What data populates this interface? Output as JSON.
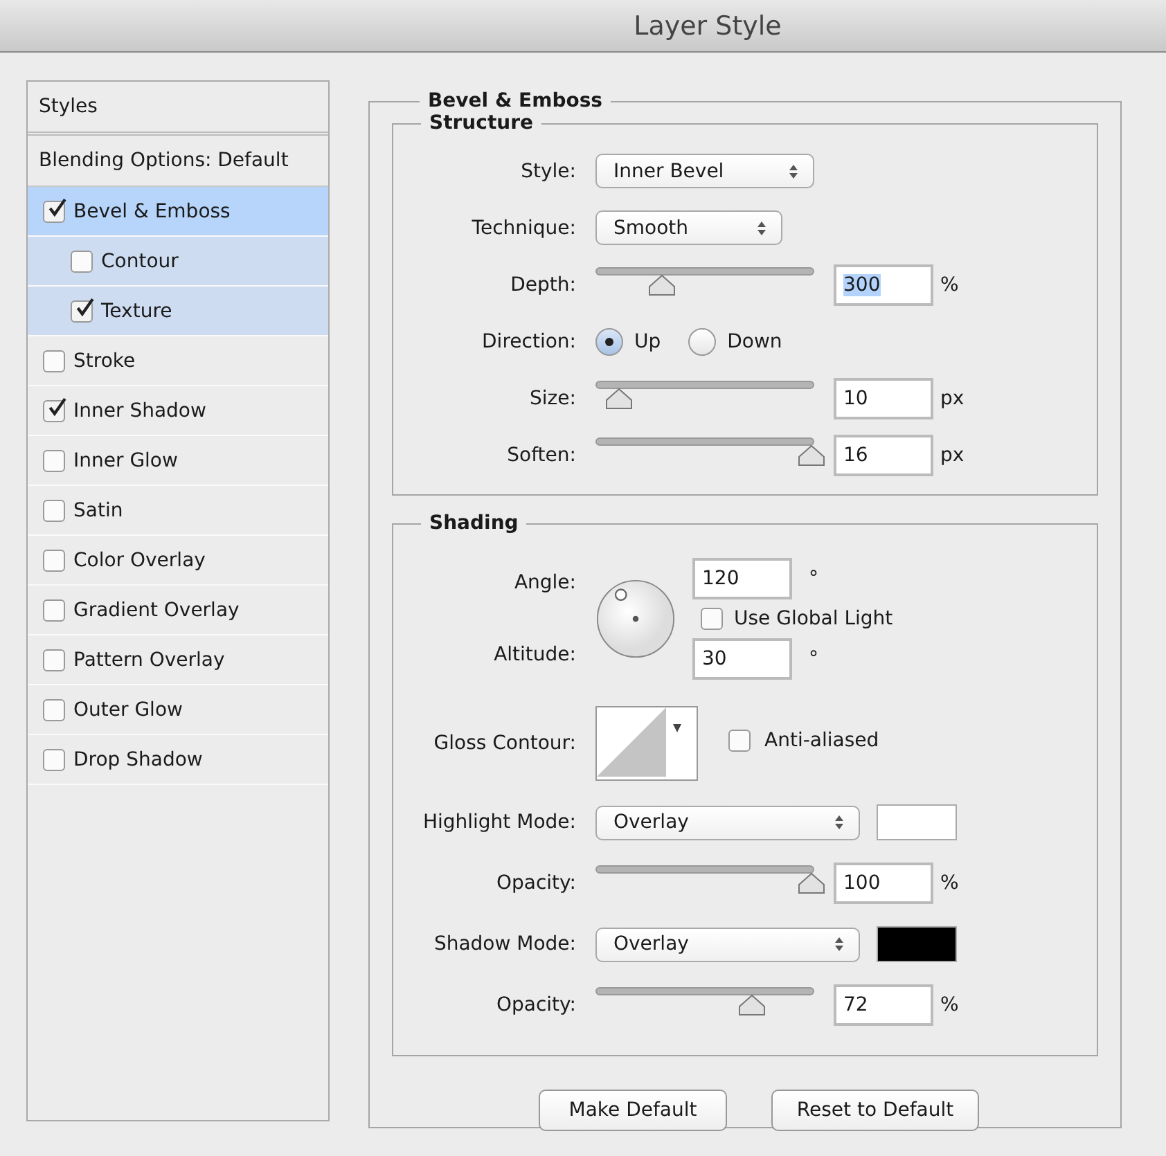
{
  "window": {
    "title": "Layer Style"
  },
  "sidebar": {
    "header": "Styles",
    "blending": "Blending Options: Default",
    "items": [
      {
        "label": "Bevel & Emboss",
        "checked": true,
        "selected": true,
        "children": [
          {
            "label": "Contour",
            "checked": false,
            "selected": false
          },
          {
            "label": "Texture",
            "checked": true,
            "selected": false
          }
        ]
      },
      {
        "label": "Stroke",
        "checked": false,
        "selected": false
      },
      {
        "label": "Inner Shadow",
        "checked": true,
        "selected": false
      },
      {
        "label": "Inner Glow",
        "checked": false,
        "selected": false
      },
      {
        "label": "Satin",
        "checked": false,
        "selected": false
      },
      {
        "label": "Color Overlay",
        "checked": false,
        "selected": false
      },
      {
        "label": "Gradient Overlay",
        "checked": false,
        "selected": false
      },
      {
        "label": "Pattern Overlay",
        "checked": false,
        "selected": false
      },
      {
        "label": "Outer Glow",
        "checked": false,
        "selected": false
      },
      {
        "label": "Drop Shadow",
        "checked": false,
        "selected": false
      }
    ]
  },
  "panel": {
    "title": "Bevel & Emboss",
    "structure": {
      "title": "Structure",
      "rows": [
        {
          "kind": "select",
          "label": "Style:",
          "value": "Inner Bevel"
        },
        {
          "kind": "select",
          "label": "Technique:",
          "value": "Smooth"
        },
        {
          "kind": "slider",
          "label": "Depth:",
          "level": 0.3,
          "value": "300",
          "unit": "%",
          "highlighted": true
        },
        {
          "kind": "radio",
          "label": "Direction:",
          "options": [
            {
              "label": "Up",
              "selected": true
            },
            {
              "label": "Down",
              "selected": false
            }
          ]
        },
        {
          "kind": "slider",
          "label": "Size:",
          "level": 0.1,
          "value": "10",
          "unit": "px",
          "highlighted": false
        },
        {
          "kind": "slider",
          "label": "Soften:",
          "level": 1.0,
          "value": "16",
          "unit": "px",
          "highlighted": false
        }
      ]
    },
    "shading": {
      "title": "Shading",
      "angle": {
        "label": "Angle:",
        "value": "120",
        "unit": "°"
      },
      "use_global_light": {
        "label": "Use Global Light",
        "checked": false
      },
      "altitude": {
        "label": "Altitude:",
        "value": "30",
        "unit": "°"
      },
      "gloss_contour": {
        "label": "Gloss Contour:"
      },
      "anti_aliased": {
        "label": "Anti-aliased",
        "checked": false
      },
      "rows": [
        {
          "kind": "select",
          "label": "Highlight Mode:",
          "value": "Overlay",
          "color": "#ffffff"
        },
        {
          "kind": "slider",
          "label": "Opacity:",
          "level": 1.0,
          "value": "100",
          "unit": "%",
          "highlighted": false
        },
        {
          "kind": "select",
          "label": "Shadow Mode:",
          "value": "Overlay",
          "color": "#000000"
        },
        {
          "kind": "slider",
          "label": "Opacity:",
          "level": 0.72,
          "value": "72",
          "unit": "%",
          "highlighted": false
        }
      ]
    }
  },
  "buttons": [
    "Make Default",
    "Reset to Default"
  ]
}
